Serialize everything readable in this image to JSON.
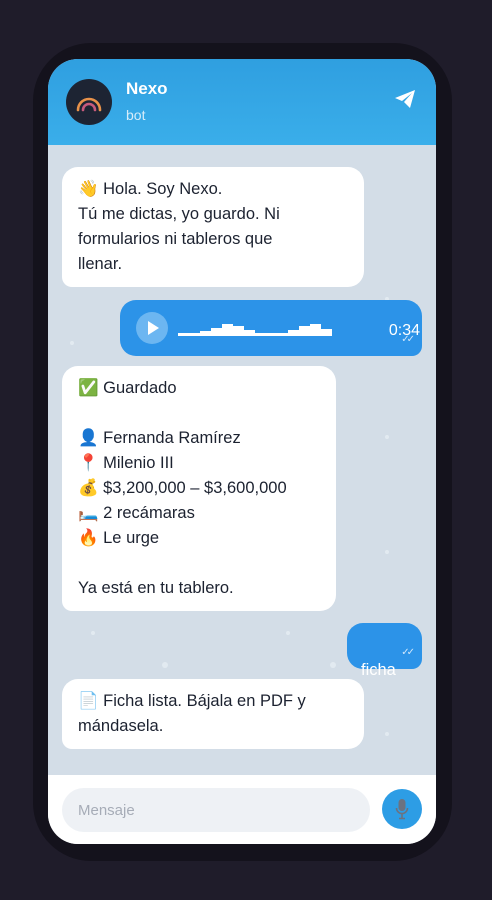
{
  "header": {
    "name": "Nexo",
    "status": "bot"
  },
  "messages": [
    {
      "type": "incoming",
      "text": "👋 Hola. Soy Nexo.\nTú me dictas, yo guardo. Ni\nformularios ni tableros que\nllenar."
    },
    {
      "type": "outgoing-voice",
      "duration": "0:34",
      "ticks": "✓✓"
    },
    {
      "type": "incoming",
      "text": "✅ Guardado\n\n👤 Fernanda Ramírez\n📍 Milenio III\n💰 $3,200,000 – $3,600,000\n🛏️ 2 recámaras\n🔥 Le urge\n\nYa está en tu tablero."
    },
    {
      "type": "outgoing",
      "text": "ficha",
      "ticks": "✓✓"
    },
    {
      "type": "incoming",
      "text": "📄 Ficha lista. Bájala en PDF y\nmándasela."
    }
  ],
  "composer": {
    "placeholder": "Mensaje"
  },
  "colors": {
    "header": "#3aaeea",
    "chat_bg": "#d3dde7",
    "outgoing_bubble": "#2c93e8",
    "page_bg": "#1f1c2a"
  },
  "icons": {
    "send": "paper-plane-icon",
    "avatar": "rainbow-logo",
    "mic": "microphone-icon"
  }
}
